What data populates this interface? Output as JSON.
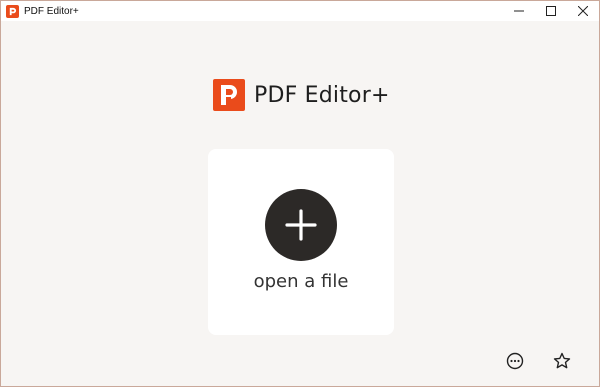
{
  "window": {
    "title": "PDF Editor+",
    "icon": "app-logo-icon",
    "controls": [
      "minimize-icon",
      "maximize-icon",
      "close-icon"
    ]
  },
  "brand": {
    "name": "PDF Editor+",
    "logo": "pdf-editor-logo-icon",
    "logo_color": "#ea4b1b"
  },
  "open_file": {
    "label": "open a file",
    "icon": "plus-icon",
    "circle_color": "#2c2927"
  },
  "bottom_actions": [
    {
      "icon": "more-options-icon"
    },
    {
      "icon": "star-icon"
    }
  ],
  "colors": {
    "background": "#f7f5f3",
    "card": "#ffffff",
    "accent": "#ea4b1b"
  }
}
